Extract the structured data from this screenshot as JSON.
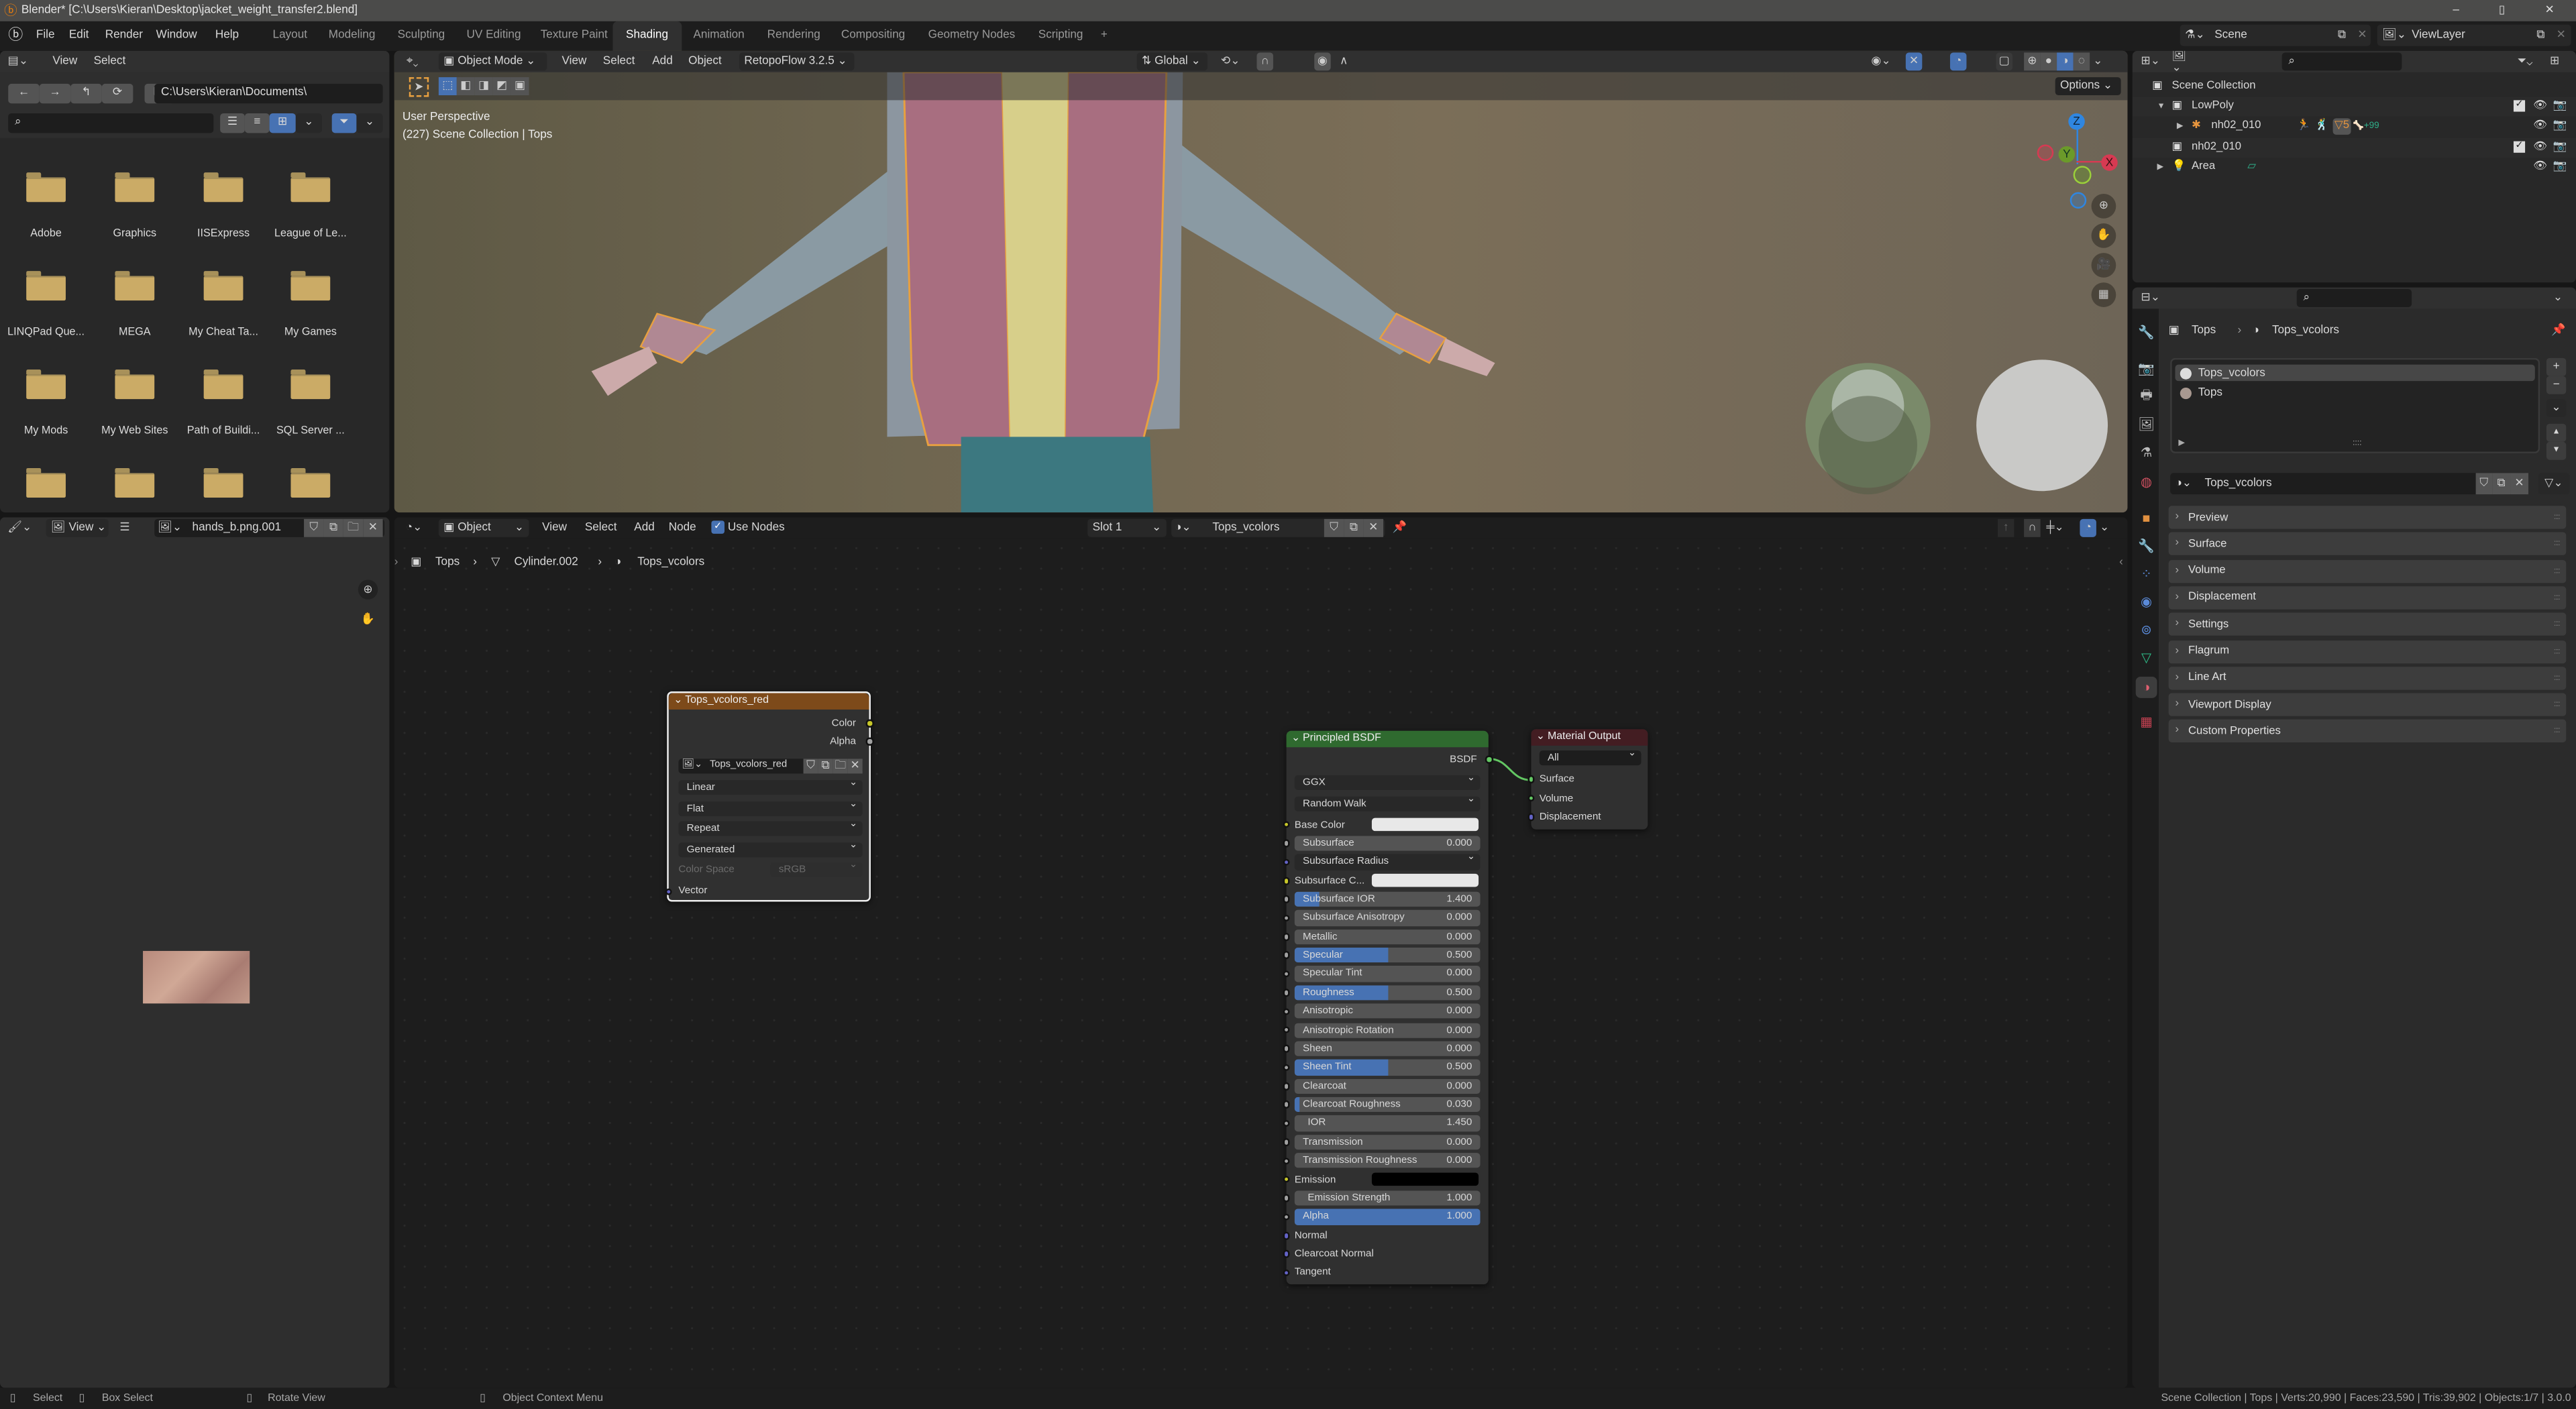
{
  "window": {
    "title": "Blender* [C:\\Users\\Kieran\\Desktop\\jacket_weight_transfer2.blend]",
    "controls": [
      "–",
      "▯",
      "✕"
    ]
  },
  "menubar": {
    "menus": [
      "File",
      "Edit",
      "Render",
      "Window",
      "Help"
    ],
    "workspaces": [
      "Layout",
      "Modeling",
      "Sculpting",
      "UV Editing",
      "Texture Paint",
      "Shading",
      "Animation",
      "Rendering",
      "Compositing",
      "Geometry Nodes",
      "Scripting"
    ],
    "active_workspace": "Shading",
    "add_workspace": "+",
    "scene": "Scene",
    "view_layer": "ViewLayer"
  },
  "file_browser": {
    "menus": [
      "View",
      "Select"
    ],
    "path": "C:\\Users\\Kieran\\Documents\\",
    "search_placeholder": "",
    "folders": [
      "Adobe",
      "Graphics",
      "IISExpress",
      "League of Le...",
      "LINQPad Que...",
      "MEGA",
      "My Cheat Ta...",
      "My Games",
      "My Mods",
      "My Web Sites",
      "Path of Buildi...",
      "SQL Server ...",
      "",
      "",
      "",
      ""
    ],
    "display_mode": "thumbnails",
    "filter_enabled": true
  },
  "viewport": {
    "mode": "Object Mode",
    "menus": [
      "View",
      "Select",
      "Add",
      "Object"
    ],
    "addon_menu": "RetopoFlow 3.2.5",
    "orientation": "Global",
    "options_label": "Options",
    "overlay_line1": "User Perspective",
    "overlay_line2": "(227) Scene Collection | Tops",
    "gizmo_axes": [
      "X",
      "Y",
      "Z"
    ],
    "shading_mode": "material-preview",
    "colors": {
      "x": "#d63a52",
      "y": "#6b9a2a",
      "z": "#2f86e0"
    }
  },
  "outliner": {
    "search_placeholder": "",
    "rows": [
      {
        "label": "Scene Collection",
        "icon": "collection-icon",
        "depth": 0,
        "expand": ""
      },
      {
        "label": "LowPoly",
        "icon": "collection-icon",
        "depth": 1,
        "expand": "▼",
        "checkbox": true
      },
      {
        "label": "nh02_010",
        "icon": "armature-icon",
        "depth": 2,
        "expand": "▶",
        "badges": [
          "5",
          "+99"
        ]
      },
      {
        "label": "nh02_010",
        "icon": "collection-icon",
        "depth": 1,
        "expand": "",
        "checkbox": true
      },
      {
        "label": "Area",
        "icon": "light-icon",
        "depth": 1,
        "expand": "▶"
      }
    ]
  },
  "image_editor": {
    "menus": [
      "View"
    ],
    "image_name": "hands_b.png.001"
  },
  "node_editor": {
    "object_type": "Object",
    "menus": [
      "View",
      "Select",
      "Add",
      "Node"
    ],
    "use_nodes_label": "Use Nodes",
    "use_nodes": true,
    "slot": "Slot 1",
    "material": "Tops_vcolors",
    "breadcrumb": [
      "Tops",
      "Cylinder.002",
      "Tops_vcolors"
    ],
    "image_node": {
      "title": "Tops_vcolors_red",
      "outputs": [
        "Color",
        "Alpha"
      ],
      "image": "Tops_vcolors_red",
      "interpolation": "Linear",
      "projection": "Flat",
      "extension": "Repeat",
      "source": "Generated",
      "color_space_label": "Color Space",
      "color_space": "sRGB",
      "input": "Vector",
      "header_color": "#7d4a1a"
    },
    "principled": {
      "title": "Principled BSDF",
      "output": "BSDF",
      "distribution": "GGX",
      "subsurface_method": "Random Walk",
      "header_color": "#2f6a2f",
      "inputs": [
        {
          "label": "Base Color",
          "type": "color",
          "socket": "#c7c729",
          "color": "#e8e8e8"
        },
        {
          "label": "Subsurface",
          "type": "slider",
          "value": "0.000",
          "fill": 0,
          "socket": "#a1a1a1"
        },
        {
          "label": "Subsurface Radius",
          "type": "dropdown",
          "socket": "#6363c7"
        },
        {
          "label": "Subsurface C...",
          "type": "color",
          "socket": "#c7c729",
          "color": "#e8e8e8"
        },
        {
          "label": "Subsurface IOR",
          "type": "slider",
          "value": "1.400",
          "fill": 0.13,
          "socket": "#a1a1a1"
        },
        {
          "label": "Subsurface Anisotropy",
          "type": "slider",
          "value": "0.000",
          "fill": 0,
          "socket": "#a1a1a1"
        },
        {
          "label": "Metallic",
          "type": "slider",
          "value": "0.000",
          "fill": 0,
          "socket": "#a1a1a1"
        },
        {
          "label": "Specular",
          "type": "slider",
          "value": "0.500",
          "fill": 0.5,
          "socket": "#a1a1a1"
        },
        {
          "label": "Specular Tint",
          "type": "slider",
          "value": "0.000",
          "fill": 0,
          "socket": "#a1a1a1"
        },
        {
          "label": "Roughness",
          "type": "slider",
          "value": "0.500",
          "fill": 0.5,
          "socket": "#a1a1a1"
        },
        {
          "label": "Anisotropic",
          "type": "slider",
          "value": "0.000",
          "fill": 0,
          "socket": "#a1a1a1"
        },
        {
          "label": "Anisotropic Rotation",
          "type": "slider",
          "value": "0.000",
          "fill": 0,
          "socket": "#a1a1a1"
        },
        {
          "label": "Sheen",
          "type": "slider",
          "value": "0.000",
          "fill": 0,
          "socket": "#a1a1a1"
        },
        {
          "label": "Sheen Tint",
          "type": "slider",
          "value": "0.500",
          "fill": 0.5,
          "socket": "#a1a1a1"
        },
        {
          "label": "Clearcoat",
          "type": "slider",
          "value": "0.000",
          "fill": 0,
          "socket": "#a1a1a1"
        },
        {
          "label": "Clearcoat Roughness",
          "type": "slider",
          "value": "0.030",
          "fill": 0.03,
          "socket": "#a1a1a1"
        },
        {
          "label": "IOR",
          "type": "slider",
          "value": "1.450",
          "fill": 0,
          "socket": "#a1a1a1"
        },
        {
          "label": "Transmission",
          "type": "slider",
          "value": "0.000",
          "fill": 0,
          "socket": "#a1a1a1"
        },
        {
          "label": "Transmission Roughness",
          "type": "slider",
          "value": "0.000",
          "fill": 0,
          "socket": "#a1a1a1"
        },
        {
          "label": "Emission",
          "type": "color",
          "socket": "#c7c729",
          "color": "#000000"
        },
        {
          "label": "Emission Strength",
          "type": "slider",
          "value": "1.000",
          "fill": 0,
          "socket": "#a1a1a1"
        },
        {
          "label": "Alpha",
          "type": "slider",
          "value": "1.000",
          "fill": 1,
          "socket": "#a1a1a1"
        },
        {
          "label": "Normal",
          "type": "input",
          "socket": "#6363c7"
        },
        {
          "label": "Clearcoat Normal",
          "type": "input",
          "socket": "#6363c7"
        },
        {
          "label": "Tangent",
          "type": "input",
          "socket": "#6363c7"
        }
      ]
    },
    "output_node": {
      "title": "Material Output",
      "target": "All",
      "inputs": [
        {
          "label": "Surface",
          "socket": "#63c763"
        },
        {
          "label": "Volume",
          "socket": "#63c763"
        },
        {
          "label": "Displacement",
          "socket": "#6363c7"
        }
      ],
      "header_color": "#431d22"
    }
  },
  "properties": {
    "breadcrumb": [
      "Tops",
      "Tops_vcolors"
    ],
    "material_slots": [
      "Tops_vcolors",
      "Tops"
    ],
    "active_slot": 0,
    "material": "Tops_vcolors",
    "panels": [
      "Preview",
      "Surface",
      "Volume",
      "Displacement",
      "Settings",
      "Flagrum",
      "Line Art",
      "Viewport Display",
      "Custom Properties"
    ],
    "tabs": [
      {
        "name": "tool-tab-icon",
        "glyph": "🔧",
        "color": "#bbb"
      },
      {
        "name": "render-tab-icon",
        "glyph": "📷",
        "color": "#bbb"
      },
      {
        "name": "output-tab-icon",
        "glyph": "🖶",
        "color": "#bbb"
      },
      {
        "name": "view-layer-tab-icon",
        "glyph": "🖼",
        "color": "#bbb"
      },
      {
        "name": "scene-tab-icon",
        "glyph": "⚗",
        "color": "#bbb"
      },
      {
        "name": "world-tab-icon",
        "glyph": "◍",
        "color": "#d05060"
      },
      {
        "name": "object-tab-icon",
        "glyph": "■",
        "color": "#e09040"
      },
      {
        "name": "modifier-tab-icon",
        "glyph": "🔧",
        "color": "#5a8ad8"
      },
      {
        "name": "particles-tab-icon",
        "glyph": "⁘",
        "color": "#5a8ad8"
      },
      {
        "name": "physics-tab-icon",
        "glyph": "◉",
        "color": "#5a8ad8"
      },
      {
        "name": "constraints-tab-icon",
        "glyph": "⊚",
        "color": "#5a8ad8"
      },
      {
        "name": "data-tab-icon",
        "glyph": "▽",
        "color": "#2fc08a"
      },
      {
        "name": "material-tab-icon",
        "glyph": "◑",
        "color": "#e06070"
      },
      {
        "name": "texture-tab-icon",
        "glyph": "▦",
        "color": "#c04050"
      }
    ],
    "active_tab": "material-tab-icon"
  },
  "statusbar": {
    "hints": [
      "Select",
      "Box Select",
      "Rotate View",
      "Object Context Menu"
    ],
    "stats": "Scene Collection | Tops | Verts:20,990 | Faces:23,590 | Tris:39,902 | Objects:1/7 | 3.0.0"
  },
  "accent_color": "#4772b3"
}
